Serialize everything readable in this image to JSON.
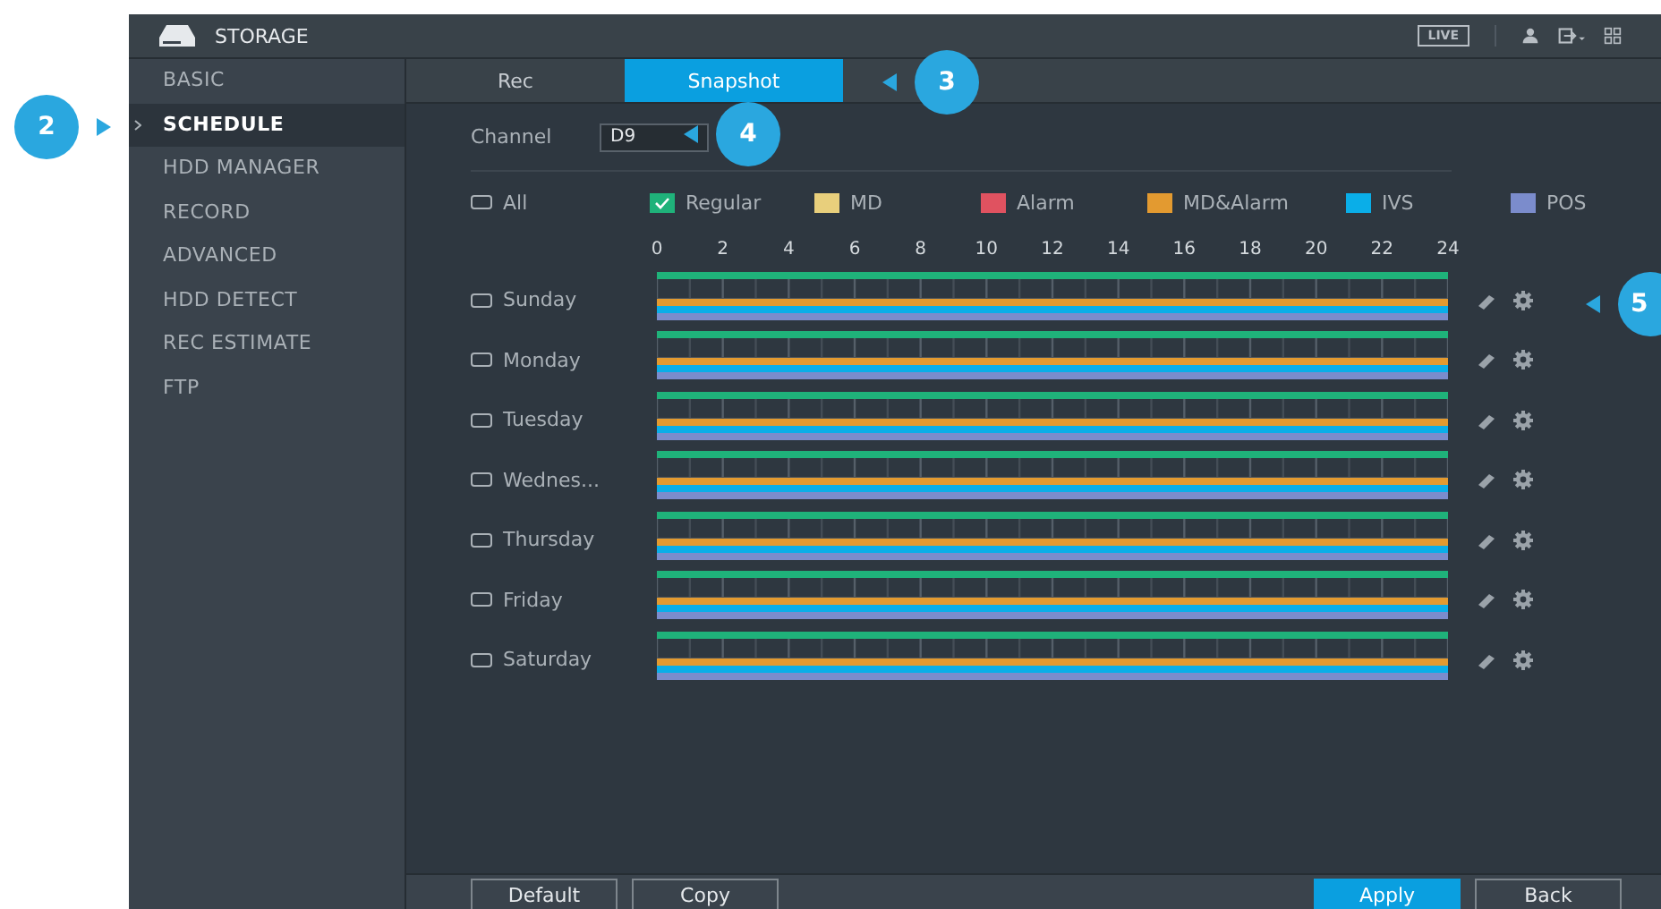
{
  "window": {
    "title": "STORAGE",
    "live_badge": "LIVE"
  },
  "sidebar": {
    "callout": "2",
    "items": [
      {
        "label": "BASIC",
        "selected": false
      },
      {
        "label": "SCHEDULE",
        "selected": true
      },
      {
        "label": "HDD MANAGER",
        "selected": false
      },
      {
        "label": "RECORD",
        "selected": false
      },
      {
        "label": "ADVANCED",
        "selected": false
      },
      {
        "label": "HDD DETECT",
        "selected": false
      },
      {
        "label": "REC ESTIMATE",
        "selected": false
      },
      {
        "label": "FTP",
        "selected": false
      }
    ]
  },
  "tabs": {
    "callout": "3",
    "items": [
      {
        "label": "Rec",
        "selected": false
      },
      {
        "label": "Snapshot",
        "selected": true
      }
    ]
  },
  "channel": {
    "label": "Channel",
    "value": "D9",
    "callout": "4"
  },
  "all_checkbox": {
    "label": "All",
    "checked": false
  },
  "legend": [
    {
      "label": "Regular",
      "color": "#1fb27a",
      "checked": true
    },
    {
      "label": "MD",
      "color": "#e8cf7c",
      "checked": false
    },
    {
      "label": "Alarm",
      "color": "#e05260",
      "checked": false
    },
    {
      "label": "MD&Alarm",
      "color": "#e39a30",
      "checked": false
    },
    {
      "label": "IVS",
      "color": "#0aaee8",
      "checked": false
    },
    {
      "label": "POS",
      "color": "#7b8ccc",
      "checked": false
    }
  ],
  "hours": [
    "0",
    "2",
    "4",
    "6",
    "8",
    "10",
    "12",
    "14",
    "16",
    "18",
    "20",
    "22",
    "24"
  ],
  "schedule_callout": "5",
  "days": [
    {
      "label": "Sunday",
      "checked": false,
      "tracks": [
        {
          "color": "#1fb27a"
        },
        {
          "color": "#e39a30"
        },
        {
          "color": "#0aaee8"
        },
        {
          "color": "#7b8ccc"
        }
      ]
    },
    {
      "label": "Monday",
      "checked": false,
      "tracks": [
        {
          "color": "#1fb27a"
        },
        {
          "color": "#e39a30"
        },
        {
          "color": "#0aaee8"
        },
        {
          "color": "#7b8ccc"
        }
      ]
    },
    {
      "label": "Tuesday",
      "checked": false,
      "tracks": [
        {
          "color": "#1fb27a"
        },
        {
          "color": "#e39a30"
        },
        {
          "color": "#0aaee8"
        },
        {
          "color": "#7b8ccc"
        }
      ]
    },
    {
      "label": "Wednes...",
      "checked": false,
      "tracks": [
        {
          "color": "#1fb27a"
        },
        {
          "color": "#e39a30"
        },
        {
          "color": "#0aaee8"
        },
        {
          "color": "#7b8ccc"
        }
      ]
    },
    {
      "label": "Thursday",
      "checked": false,
      "tracks": [
        {
          "color": "#1fb27a"
        },
        {
          "color": "#e39a30"
        },
        {
          "color": "#0aaee8"
        },
        {
          "color": "#7b8ccc"
        }
      ]
    },
    {
      "label": "Friday",
      "checked": false,
      "tracks": [
        {
          "color": "#1fb27a"
        },
        {
          "color": "#e39a30"
        },
        {
          "color": "#0aaee8"
        },
        {
          "color": "#7b8ccc"
        }
      ]
    },
    {
      "label": "Saturday",
      "checked": false,
      "tracks": [
        {
          "color": "#1fb27a"
        },
        {
          "color": "#e39a30"
        },
        {
          "color": "#0aaee8"
        },
        {
          "color": "#7b8ccc"
        }
      ]
    }
  ],
  "buttons": [
    {
      "label": "Default",
      "kind": "plain"
    },
    {
      "label": "Copy",
      "kind": "plain"
    },
    {
      "label": "Apply",
      "kind": "primary"
    },
    {
      "label": "Back",
      "kind": "plain"
    }
  ]
}
